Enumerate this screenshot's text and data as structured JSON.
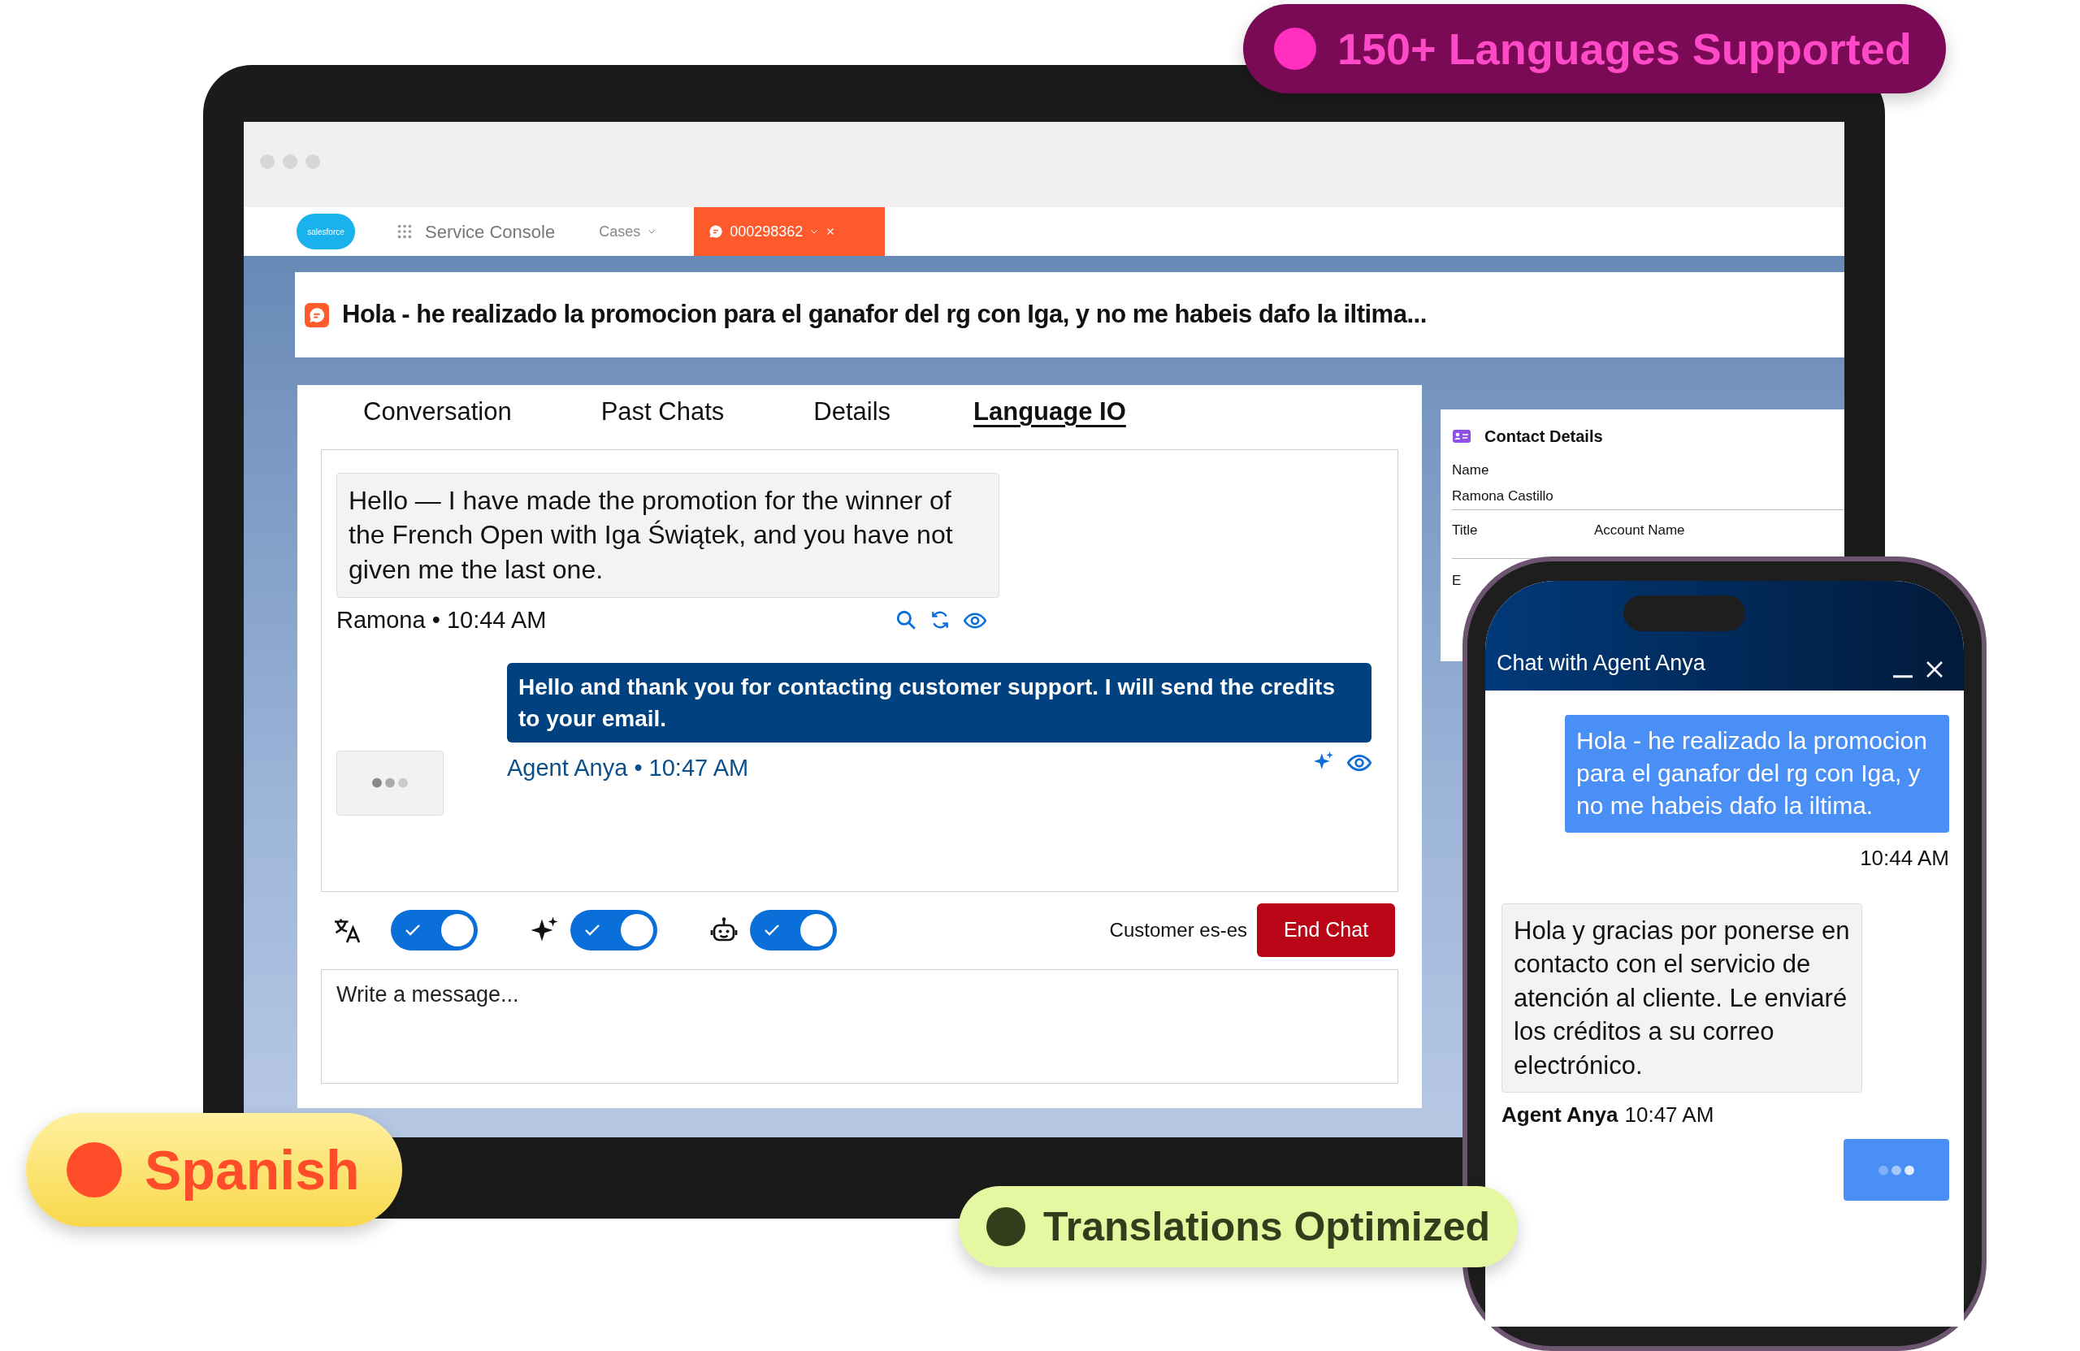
{
  "console": {
    "logo_text": "salesforce",
    "app_name": "Service Console",
    "nav_item": "Cases",
    "record_tab": {
      "label": "000298362",
      "selected": true
    },
    "subject": "Hola - he realizado la promocion para el ganafor del rg con Iga, y no me habeis dafo la iltima...",
    "tabs": [
      {
        "label": "Conversation",
        "selected": false
      },
      {
        "label": "Past Chats",
        "selected": false
      },
      {
        "label": "Details",
        "selected": false
      },
      {
        "label": "Language IO",
        "selected": true
      }
    ],
    "messages": [
      {
        "kind": "customer",
        "text": "Hello — I have made the promotion for the winner of the French Open with Iga Świątek, and you have not given me the last one.",
        "meta": "Ramona • 10:44 AM"
      },
      {
        "kind": "agent",
        "text": "Hello and thank you for contacting customer support. I will send the credits to your email.",
        "meta": "Agent Anya • 10:47 AM"
      }
    ],
    "toggles": [
      {
        "kind": "translate",
        "checked": true
      },
      {
        "kind": "sparkle",
        "checked": true
      },
      {
        "kind": "robot",
        "checked": true
      }
    ],
    "customer_language": "Customer es-es",
    "end_button": "End Chat",
    "compose": {
      "placeholder": "Write a message..."
    },
    "contact": {
      "title": "Contact Details",
      "fields": [
        {
          "label": "Name",
          "value": "Ramona Castillo"
        },
        {
          "label": "Title"
        },
        {
          "label": "Account Name"
        },
        {
          "label": "E"
        }
      ]
    }
  },
  "phone": {
    "title": "Chat with Agent Anya",
    "messages": [
      {
        "kind": "outgoing",
        "text": "Hola - he realizado la promocion para el ganafor del rg con Iga, y no me habeis dafo la iltima.",
        "time": "10:44 AM"
      },
      {
        "kind": "incoming",
        "text": "Hola y gracias por ponerse en contacto con el servicio de atención al cliente. Le enviaré los créditos a su correo electrónico.",
        "sender": "Agent Anya",
        "time": "10:47 AM"
      }
    ]
  },
  "badges": [
    {
      "kind": "languages",
      "text": "150+ Languages Supported",
      "color": "#ff2fc0"
    },
    {
      "kind": "spanish",
      "text": "Spanish",
      "color": "#ff4d2a"
    },
    {
      "kind": "optimized",
      "text": "Translations Optimized",
      "color": "#333d1c"
    }
  ]
}
